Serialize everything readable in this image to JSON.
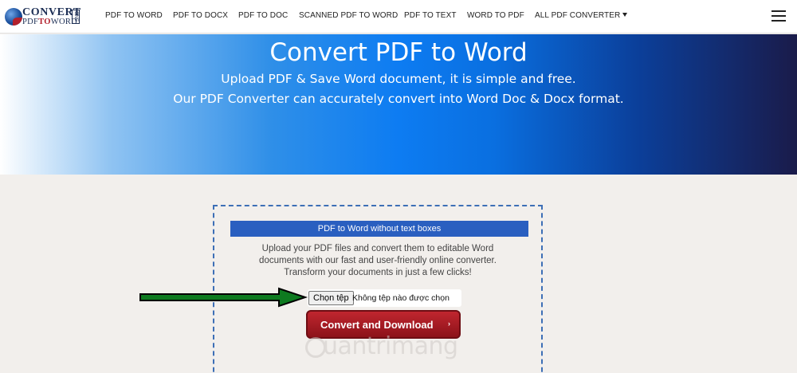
{
  "logo": {
    "line1": "CONVERT",
    "line2a": "PDF",
    "line2b": "TO",
    "line2c": "WORD",
    "badge": "ONE"
  },
  "nav": {
    "items": [
      "PDF TO WORD",
      "PDF TO DOCX",
      "PDF TO DOC",
      "SCANNED PDF TO WORD",
      "PDF TO TEXT",
      "WORD TO PDF",
      "ALL PDF CONVERTER"
    ],
    "menu_icon": "hamburger-icon"
  },
  "hero": {
    "title": "Convert PDF to Word",
    "subtitle1": "Upload PDF & Save Word document, it is simple and free.",
    "subtitle2": "Our PDF Converter can accurately convert into Word Doc & Docx format."
  },
  "converter": {
    "header": "PDF to Word without text boxes",
    "desc1": "Upload your PDF files and convert them to editable Word",
    "desc2": "documents with our fast and user-friendly online converter.",
    "desc3": "Transform your documents in just a few clicks!",
    "file_button": "Chọn tệp",
    "file_status": "Không tệp nào được chọn",
    "convert_label": "Convert and Download",
    "convert_chevron": "›"
  },
  "watermark": {
    "text": "uantrimang"
  },
  "colors": {
    "accent": "#2a5fc0",
    "button_red": "#a81b24",
    "arrow_green": "#0e7a20",
    "page_bg": "#f2efec"
  }
}
